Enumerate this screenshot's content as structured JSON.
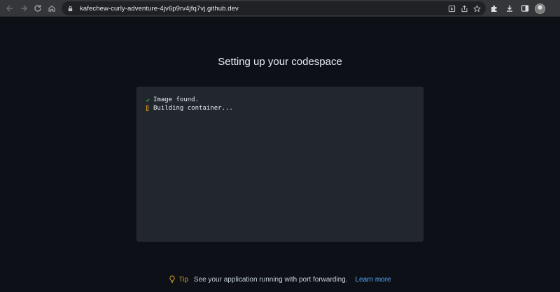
{
  "browser": {
    "url": "kafechew-curly-adventure-4jv6p9rv4jfq7vj.github.dev",
    "icons": [
      "back-icon",
      "forward-icon",
      "reload-icon",
      "home-icon",
      "lock-icon",
      "install-icon",
      "share-icon",
      "star-icon",
      "extensions-icon",
      "download-icon",
      "side-panel-icon",
      "profile-avatar"
    ]
  },
  "main": {
    "title": "Setting up your codespace",
    "log": [
      {
        "status": "done",
        "text": "Image found."
      },
      {
        "status": "running",
        "text": "Building container..."
      }
    ]
  },
  "tip": {
    "label": "Tip",
    "text": "See your application running with port forwarding.",
    "link": "Learn more"
  },
  "colors": {
    "background": "#0d1117",
    "terminal": "#22272e",
    "success": "#3fb950",
    "warning": "#d29922",
    "link": "#58a6ff"
  }
}
